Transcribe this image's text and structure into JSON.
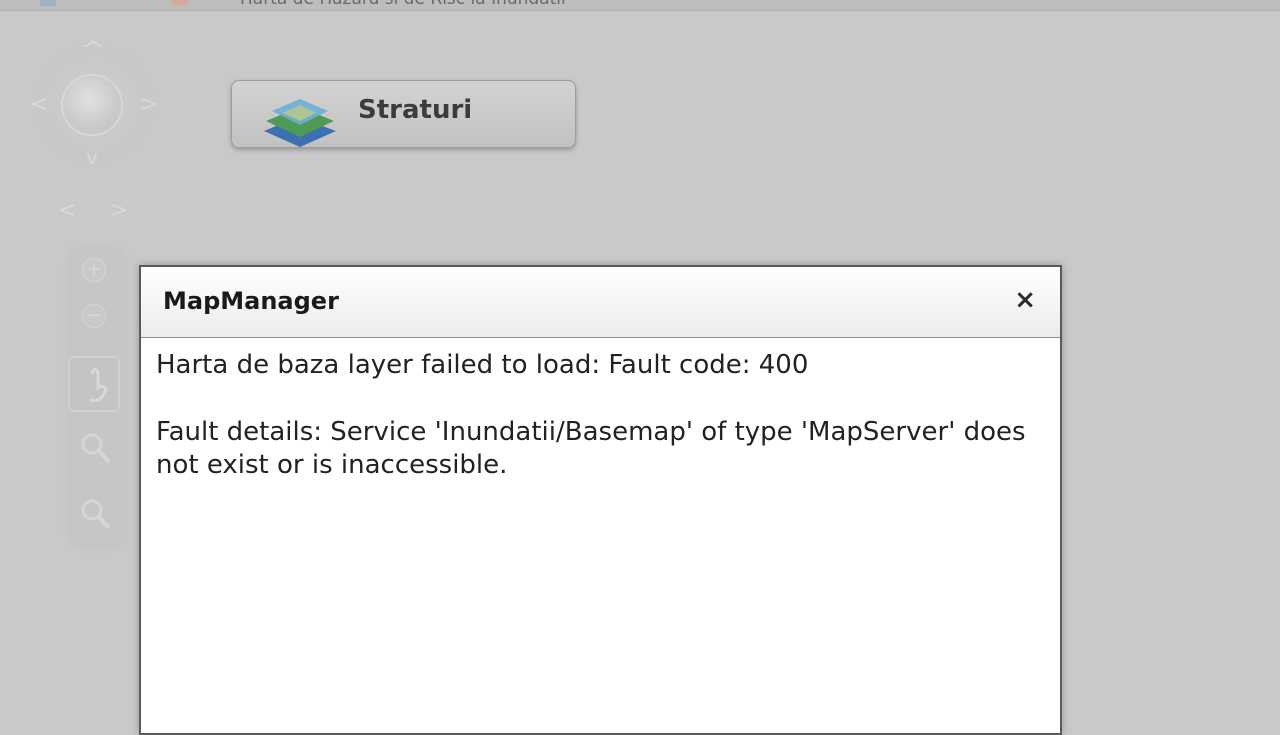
{
  "topbar": {
    "title": "Harta de Hazard si de Risc la Inundatii"
  },
  "navigation": {
    "pan_up": "^",
    "pan_down": "v",
    "pan_left": "<",
    "pan_right": ">",
    "prev_extent": "<",
    "next_extent": ">",
    "zoom_in": "+",
    "zoom_out": "−"
  },
  "layers_button": {
    "label": "Straturi"
  },
  "dialog": {
    "title": "MapManager",
    "close": "×",
    "message": "Harta de baza layer failed to load: Fault code: 400",
    "details": "Fault details: Service 'Inundatii/Basemap' of type 'MapServer' does not exist or is inaccessible."
  },
  "colors": {
    "overlay_background": "#c9c9c9",
    "dialog_background": "#ffffff",
    "dialog_border": "#5a5a5a",
    "text": "#222222"
  }
}
